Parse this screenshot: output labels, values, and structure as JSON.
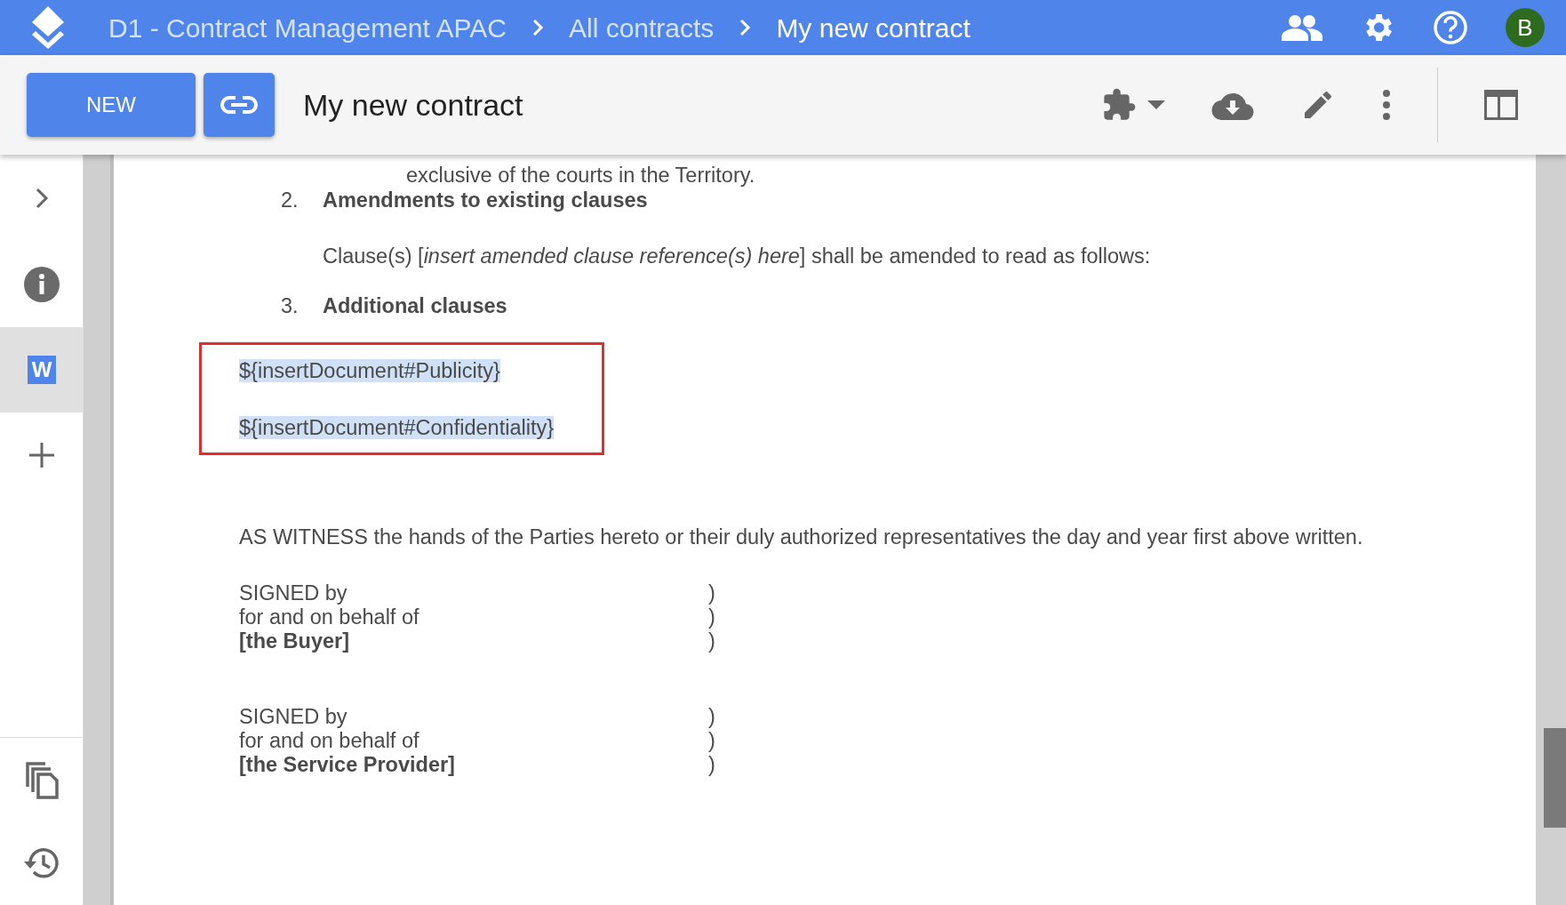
{
  "breadcrumb": [
    {
      "text": "D1 - Contract Management APAC",
      "current": false
    },
    {
      "text": "All contracts",
      "current": false
    },
    {
      "text": "My new contract",
      "current": true
    }
  ],
  "avatar": "B",
  "toolbar": {
    "new_button": "NEW",
    "title": "My new contract"
  },
  "sidebar": {
    "items": [
      {
        "kind": "expand",
        "selected": false
      },
      {
        "kind": "info",
        "selected": false
      },
      {
        "kind": "word",
        "label": "W",
        "selected": true
      },
      {
        "kind": "add",
        "selected": false
      }
    ],
    "bottom_items": [
      {
        "kind": "copy"
      },
      {
        "kind": "history"
      }
    ]
  },
  "document": {
    "blocks": [
      {
        "kind": "continuation",
        "text": "exclusive of the courts in the Territory."
      },
      {
        "kind": "heading",
        "number": "2.",
        "text": "Amendments to existing clauses"
      },
      {
        "kind": "clause",
        "text": "Clause(s) [*insert amended clause reference(s) here*] shall be amended to read as follows:"
      },
      {
        "kind": "heading",
        "number": "3.",
        "text": "Additional clauses"
      },
      {
        "kind": "placeholders",
        "highlighted": true,
        "lines": [
          "${insertDocument#Publicity}",
          "${insertDocument#Confidentiality}"
        ]
      },
      {
        "kind": "witness",
        "text": "AS WITNESS the hands of the Parties hereto or their duly authorized representatives the day and year first above written."
      },
      {
        "kind": "signature",
        "lines": [
          {
            "text": "SIGNED by",
            "party": false,
            "bracket": ")"
          },
          {
            "text": "for and on behalf of",
            "party": false,
            "bracket": ")"
          },
          {
            "text": "[the Buyer]",
            "party": true,
            "bracket": ")"
          }
        ]
      },
      {
        "kind": "signature",
        "lines": [
          {
            "text": "SIGNED by",
            "party": false,
            "bracket": ")"
          },
          {
            "text": "for and on behalf of",
            "party": false,
            "bracket": ")"
          },
          {
            "text": "[the Service Provider]",
            "party": true,
            "bracket": ")"
          }
        ]
      }
    ]
  }
}
